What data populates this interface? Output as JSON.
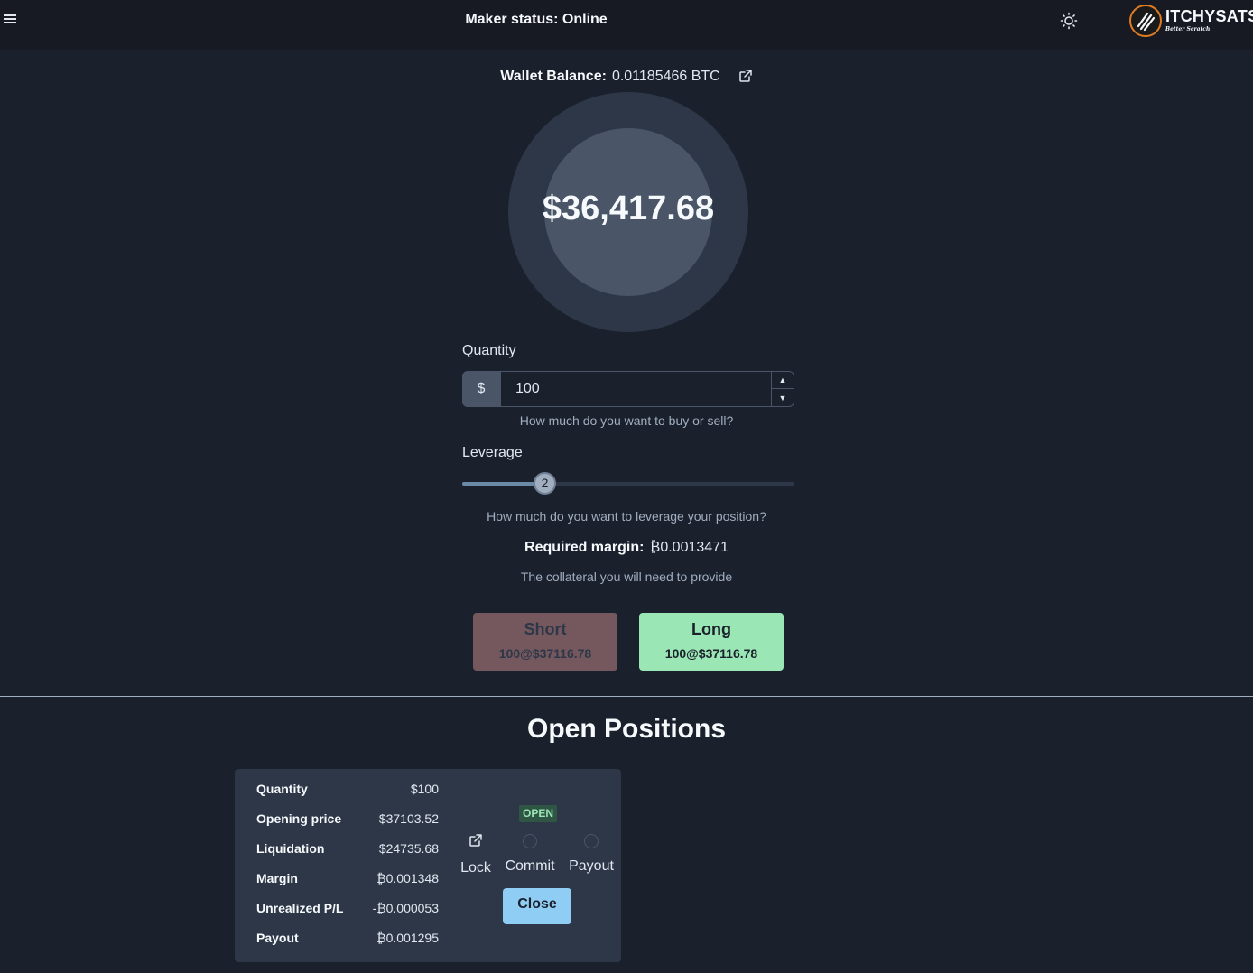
{
  "header": {
    "maker_status": "Maker status: Online",
    "logo_text": "ITCHYSATS",
    "logo_tagline": "Better Scratch"
  },
  "wallet": {
    "label": "Wallet Balance:",
    "value": "0.01185466 BTC"
  },
  "price": {
    "value": "$36,417.68"
  },
  "quantity": {
    "label": "Quantity",
    "addon": "$",
    "value": "100",
    "help": "How much do you want to buy or sell?"
  },
  "leverage": {
    "label": "Leverage",
    "value": "2",
    "fraction": 0.25,
    "help": "How much do you want to leverage your position?"
  },
  "margin": {
    "label": "Required margin:",
    "value": "₿0.0013471",
    "help": "The collateral you will need to provide"
  },
  "actions": {
    "short_label": "Short",
    "short_sub": "100@$37116.78",
    "long_label": "Long",
    "long_sub": "100@$37116.78"
  },
  "open_positions": {
    "heading": "Open Positions",
    "rows": [
      {
        "key": "Quantity",
        "value": "$100"
      },
      {
        "key": "Opening price",
        "value": "$37103.52"
      },
      {
        "key": "Liquidation",
        "value": "$24735.68"
      },
      {
        "key": "Margin",
        "value": "₿0.001348"
      },
      {
        "key": "Unrealized P/L",
        "value": "-₿0.000053"
      },
      {
        "key": "Payout",
        "value": "₿0.001295"
      }
    ],
    "status_badge": "OPEN",
    "steps": [
      "Lock",
      "Commit",
      "Payout"
    ],
    "close_label": "Close"
  },
  "colors": {
    "background": "#1a202c",
    "header": "#171923",
    "short": "#74585e",
    "long": "#9ae6b4",
    "close": "#90cdf4"
  }
}
